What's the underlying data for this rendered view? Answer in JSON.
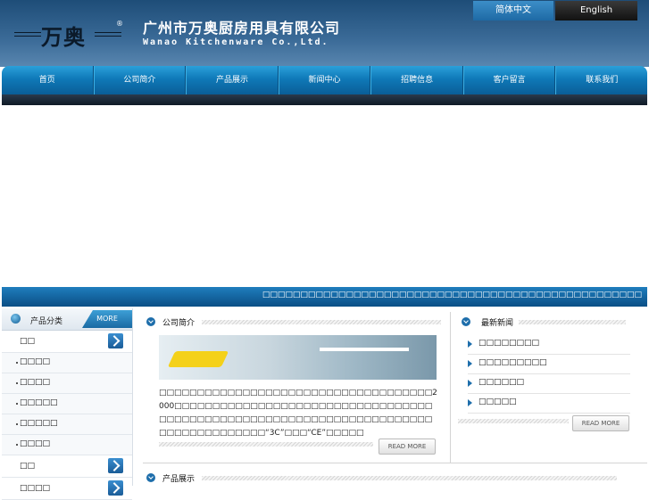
{
  "header": {
    "logo_text": "万奥",
    "logo_reg": "®",
    "company_cn": "广州市万奥厨房用具有限公司",
    "company_en": "Wanao Kitchenware Co.,Ltd.",
    "lang_cn": "简体中文",
    "lang_en": "English"
  },
  "nav": [
    "首页",
    "公司简介",
    "产品展示",
    "新闻中心",
    "招聘信息",
    "客户留言",
    "联系我们"
  ],
  "banner": {
    "marquee": "□□□□□□□□□□□□□□□□□□□□□□□□□□□□□□□□□□□□□□□□□□□□□□□□□□"
  },
  "sidebar": {
    "title": "产品分类",
    "more": "MORE",
    "categories": [
      {
        "label": "□□",
        "type": "main"
      },
      {
        "label": "□□□□",
        "type": "sub"
      },
      {
        "label": "□□□□",
        "type": "sub"
      },
      {
        "label": "□□□□□",
        "type": "sub"
      },
      {
        "label": "□□□□□",
        "type": "sub"
      },
      {
        "label": "□□□□",
        "type": "sub"
      },
      {
        "label": "□□",
        "type": "main"
      },
      {
        "label": "□□□□",
        "type": "main"
      }
    ]
  },
  "about": {
    "title": "公司简介",
    "text": "□□□□□□□□□□□□□□□□□□□□□□□□□□□□□□□□□□□□2000□□□□□□□□□□□□□□□□□□□□□□□□□□□□□□□□□□□□□□□□□□□□□□□□□□□□□□□□□□□□□□□□□□□□□□□□□□□□□□□□□□□□“3C”□□□“CE”□□□□□",
    "readmore": "READ MORE"
  },
  "news": {
    "title": "最新新闻",
    "items": [
      "□□□□□□□□",
      "□□□□□□□□□",
      "□□□□□□",
      "□□□□□"
    ],
    "readmore": "READ MORE"
  },
  "products": {
    "title": "产品展示"
  }
}
